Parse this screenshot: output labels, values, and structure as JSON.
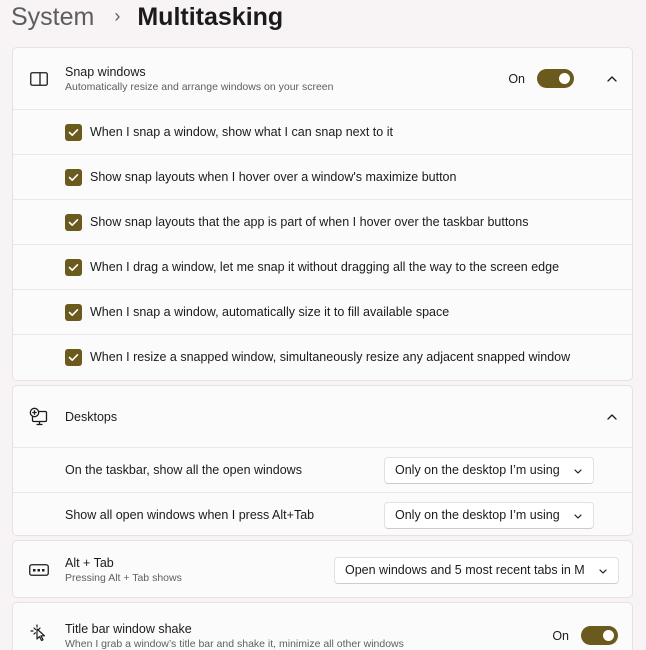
{
  "breadcrumb": {
    "root": "System",
    "separator": "›",
    "current": "Multitasking"
  },
  "snap": {
    "title": "Snap windows",
    "subtitle": "Automatically resize and arrange windows on your screen",
    "toggle_state": "On",
    "toggle_on": true,
    "options": [
      {
        "label": "When I snap a window, show what I can snap next to it",
        "checked": true
      },
      {
        "label": "Show snap layouts when I hover over a window's maximize button",
        "checked": true
      },
      {
        "label": "Show snap layouts that the app is part of when I hover over the taskbar buttons",
        "checked": true
      },
      {
        "label": "When I drag a window, let me snap it without dragging all the way to the screen edge",
        "checked": true
      },
      {
        "label": "When I snap a window, automatically size it to fill available space",
        "checked": true
      },
      {
        "label": "When I resize a snapped window, simultaneously resize any adjacent snapped window",
        "checked": true
      }
    ]
  },
  "desktops": {
    "title": "Desktops",
    "settings": [
      {
        "label": "On the taskbar, show all the open windows",
        "value": "Only on the desktop I’m using"
      },
      {
        "label": "Show all open windows when I press Alt+Tab",
        "value": "Only on the desktop I’m using"
      }
    ]
  },
  "alttab": {
    "title": "Alt + Tab",
    "subtitle": "Pressing Alt + Tab shows",
    "value": "Open windows and 5 most recent tabs in M"
  },
  "shake": {
    "title": "Title bar window shake",
    "subtitle": "When I grab a window’s title bar and shake it, minimize all other windows",
    "toggle_state": "On",
    "toggle_on": true
  },
  "icons": {
    "snap": "snap-windows-icon",
    "desktops": "virtual-desktops-icon",
    "alttab": "alt-tab-icon",
    "shake": "window-shake-icon",
    "chevron": "chevron-up-icon",
    "dropdown": "chevron-down-icon",
    "check": "checkmark-icon"
  },
  "colors": {
    "accent": "#6b5a1e",
    "background": "#f8f3f5",
    "card": "#fcfbfc"
  }
}
